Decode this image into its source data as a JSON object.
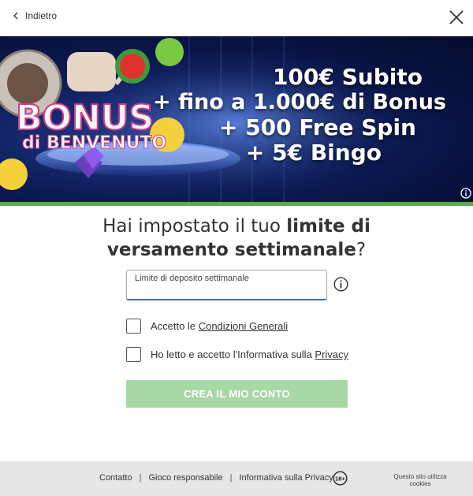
{
  "topbar": {
    "back_label": "Indietro"
  },
  "banner": {
    "logo_main": "BONUS",
    "logo_sub": "di BENVENUTO",
    "promo_lines": [
      "100€ Subito",
      "+ fino a 1.000€ di Bonus",
      "+ 500 Free Spin",
      "+ 5€ Bingo"
    ]
  },
  "form": {
    "heading_part1": "Hai impostato il tuo ",
    "heading_bold1": "limite di",
    "heading_bold2": "versamento settimanale",
    "heading_end": "?",
    "deposit_label": "Limite di deposito settimanale",
    "deposit_value": "",
    "terms_prefix": "Accetto le ",
    "terms_link": "Condizioni Generali",
    "privacy_prefix": "Ho letto e accetto l'Informativa sulla ",
    "privacy_link": "Privacy",
    "submit_label": "CREA IL MIO CONTO"
  },
  "footer": {
    "links": [
      "Contatto",
      "Gioco responsabile",
      "Informativa sulla Privacy"
    ],
    "age_badge": "18+",
    "cookies_line1": "Questo sito utilizza",
    "cookies_line2": "cookies"
  },
  "colors": {
    "accent_green": "#5aa84a",
    "cta_disabled": "#a8d8a6",
    "field_focus": "#3b6fb6"
  }
}
